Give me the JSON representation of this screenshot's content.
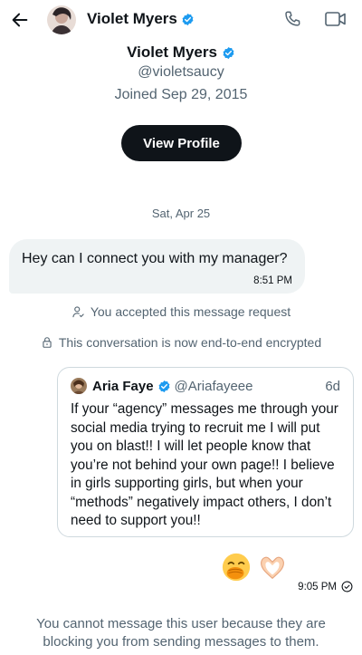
{
  "header": {
    "name": "Violet Myers"
  },
  "profile": {
    "name": "Violet Myers",
    "handle": "@violetsaucy",
    "joined": "Joined Sep 29, 2015",
    "view_profile_label": "View Profile"
  },
  "conversation": {
    "date_separator": "Sat, Apr 25",
    "incoming_message": {
      "text": "Hey can I connect you with my manager?",
      "time": "8:51 PM"
    },
    "system_accepted": "You accepted this message request",
    "system_encrypted": "This conversation is now end-to-end encrypted",
    "shared_post": {
      "author_name": "Aria Faye",
      "author_handle": "@Ariafayeee",
      "age": "6d",
      "text": "If your “agency” messages me through your social media trying to recruit me I will put you on blast!! I will let people know that you’re not behind your own page!! I believe in girls supporting girls, but when your “methods” negatively impact others, I don’t need to support you!!"
    },
    "outgoing_reply": {
      "emojis": [
        "face-with-hand-over-mouth",
        "heart-hands"
      ],
      "time": "9:05 PM"
    },
    "blocked_notice": "You cannot message this user because they are blocking you from sending messages to them."
  },
  "colors": {
    "text_primary": "#0f1419",
    "text_secondary": "#536471",
    "verified_blue": "#1d9bf0",
    "bubble_gray": "#eff3f4",
    "border": "#cfd9de"
  }
}
